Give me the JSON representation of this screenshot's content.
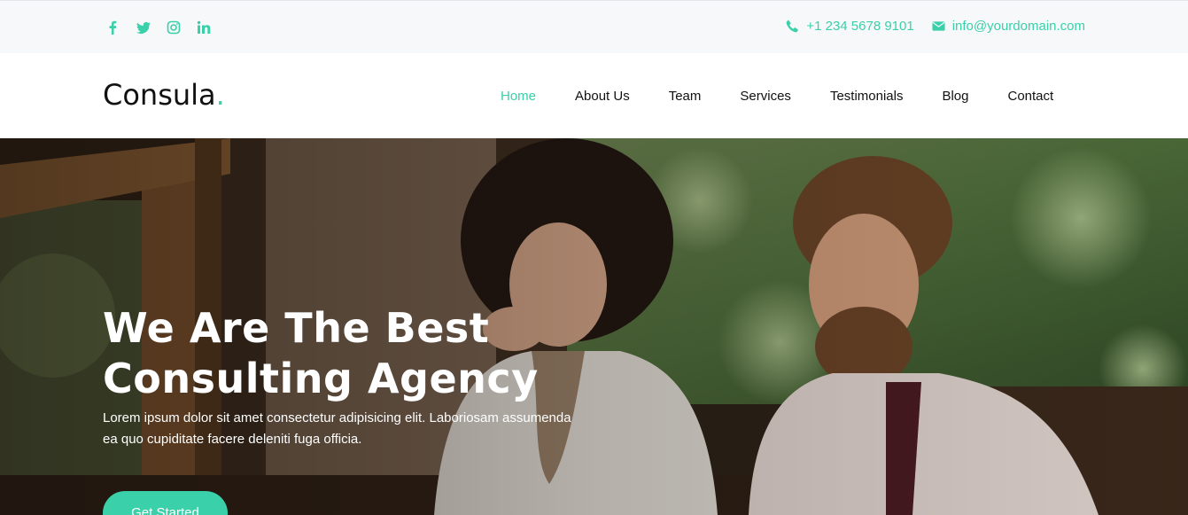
{
  "topbar": {
    "social": [
      {
        "name": "facebook-icon"
      },
      {
        "name": "twitter-icon"
      },
      {
        "name": "instagram-icon"
      },
      {
        "name": "linkedin-icon"
      }
    ],
    "phone": "+1 234 5678 9101",
    "email": "info@yourdomain.com"
  },
  "brand": {
    "name": "Consula",
    "dot": ".",
    "accent_color": "#3ad0a9"
  },
  "nav": {
    "items": [
      {
        "label": "Home",
        "active": true
      },
      {
        "label": "About Us"
      },
      {
        "label": "Team"
      },
      {
        "label": "Services"
      },
      {
        "label": "Testimonials"
      },
      {
        "label": "Blog"
      },
      {
        "label": "Contact"
      }
    ]
  },
  "hero": {
    "title_line1": "We Are The Best",
    "title_line2": "Consulting Agency",
    "text_line1": "Lorem ipsum dolor sit amet consectetur adipisicing elit. Laboriosam assumenda",
    "text_line2": "ea quo cupiditate facere deleniti fuga officia.",
    "button_label": "Get Started"
  }
}
